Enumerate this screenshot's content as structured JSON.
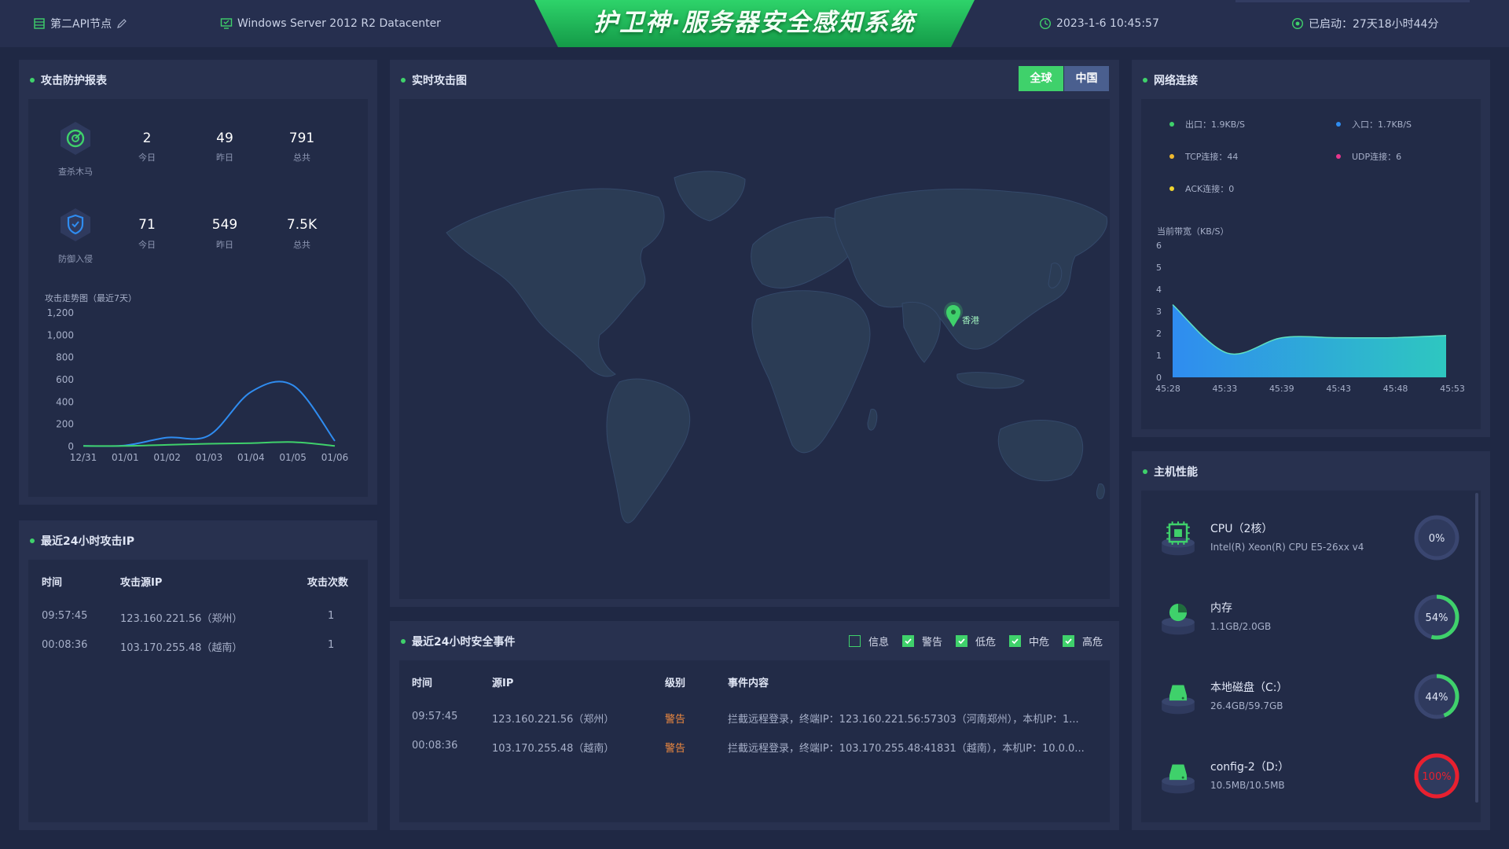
{
  "header": {
    "node_name": "第二API节点",
    "os": "Windows Server 2012 R2 Datacenter",
    "title": "护卫神·服务器安全感知系统",
    "datetime": "2023-1-6 10:45:57",
    "uptime": "已启动：27天18小时44分"
  },
  "protection": {
    "title": "攻击防护报表",
    "groups": [
      {
        "label": "查杀木马",
        "icon": "trojan-scan-icon",
        "stats": [
          {
            "value": "2",
            "label": "今日"
          },
          {
            "value": "49",
            "label": "昨日"
          },
          {
            "value": "791",
            "label": "总共"
          }
        ]
      },
      {
        "label": "防御入侵",
        "icon": "shield-icon",
        "stats": [
          {
            "value": "71",
            "label": "今日"
          },
          {
            "value": "549",
            "label": "昨日"
          },
          {
            "value": "7.5K",
            "label": "总共"
          }
        ]
      }
    ],
    "trend_title": "攻击走势图（最近7天）"
  },
  "recent_ips": {
    "title": "最近24小时攻击IP",
    "columns": [
      "时间",
      "攻击源IP",
      "攻击次数"
    ],
    "rows": [
      [
        "09:57:45",
        "123.160.221.56（郑州）",
        "1"
      ],
      [
        "00:08:36",
        "103.170.255.48（越南）",
        "1"
      ]
    ]
  },
  "attack_map": {
    "title": "实时攻击图",
    "tabs": [
      "全球",
      "中国"
    ],
    "active_tab": "全球",
    "marker_label": "香港"
  },
  "events": {
    "title": "最近24小时安全事件",
    "filters": [
      {
        "label": "信息",
        "checked": false
      },
      {
        "label": "警告",
        "checked": true
      },
      {
        "label": "低危",
        "checked": true
      },
      {
        "label": "中危",
        "checked": true
      },
      {
        "label": "高危",
        "checked": true
      }
    ],
    "columns": [
      "时间",
      "源IP",
      "级别",
      "事件内容"
    ],
    "rows": [
      [
        "09:57:45",
        "123.160.221.56（郑州）",
        "警告",
        "拦截远程登录，终端IP：123.160.221.56:57303（河南郑州），本机IP：1..."
      ],
      [
        "00:08:36",
        "103.170.255.48（越南）",
        "警告",
        "拦截远程登录，终端IP：103.170.255.48:41831（越南），本机IP：10.0.0..."
      ]
    ]
  },
  "network": {
    "title": "网络连接",
    "legend": [
      {
        "label": "出口：1.9KB/S",
        "color": "#3fd16b"
      },
      {
        "label": "入口：1.7KB/S",
        "color": "#2f8cf0"
      },
      {
        "label": "TCP连接：44",
        "color": "#f0b92f"
      },
      {
        "label": "UDP连接：6",
        "color": "#e8358c"
      },
      {
        "label": "ACK连接：0",
        "color": "#f0d42f"
      }
    ],
    "bandwidth_title": "当前带宽（KB/S）"
  },
  "host": {
    "title": "主机性能",
    "items": [
      {
        "name": "CPU（2核）",
        "sub": "Intel(R) Xeon(R) CPU E5-26xx v4",
        "percent": 0,
        "percent_label": "0%",
        "icon": "cpu-icon",
        "color": "#3fd16b"
      },
      {
        "name": "内存",
        "sub": "1.1GB/2.0GB",
        "percent": 54,
        "percent_label": "54%",
        "icon": "memory-pie-icon",
        "color": "#3fd16b"
      },
      {
        "name": "本地磁盘（C:）",
        "sub": "26.4GB/59.7GB",
        "percent": 44,
        "percent_label": "44%",
        "icon": "disk-icon",
        "color": "#3fd16b"
      },
      {
        "name": "config-2（D:）",
        "sub": "10.5MB/10.5MB",
        "percent": 100,
        "percent_label": "100%",
        "icon": "disk-icon",
        "color": "#e8202f"
      }
    ]
  },
  "chart_data": [
    {
      "type": "line",
      "title": "攻击走势图（最近7天）",
      "categories": [
        "12/31",
        "01/01",
        "01/02",
        "01/03",
        "01/04",
        "01/05",
        "01/06"
      ],
      "ylim": [
        0,
        1200
      ],
      "yticks": [
        "0",
        "200",
        "400",
        "600",
        "800",
        "1,000",
        "1,200"
      ],
      "series": [
        {
          "values": [
            5,
            10,
            80,
            100,
            490,
            550,
            50
          ],
          "color": "#2f8cf0"
        },
        {
          "values": [
            5,
            5,
            15,
            25,
            30,
            40,
            5
          ],
          "color": "#3fd16b"
        }
      ]
    },
    {
      "type": "area",
      "title": "当前带宽（KB/S）",
      "categories": [
        "45:28",
        "45:33",
        "45:39",
        "45:43",
        "45:48",
        "45:53"
      ],
      "ylim": [
        0,
        6
      ],
      "yticks": [
        "0",
        "1",
        "2",
        "3",
        "4",
        "5",
        "6"
      ],
      "values": [
        3.3,
        1.1,
        1.8,
        1.8,
        1.8,
        1.9
      ]
    }
  ]
}
